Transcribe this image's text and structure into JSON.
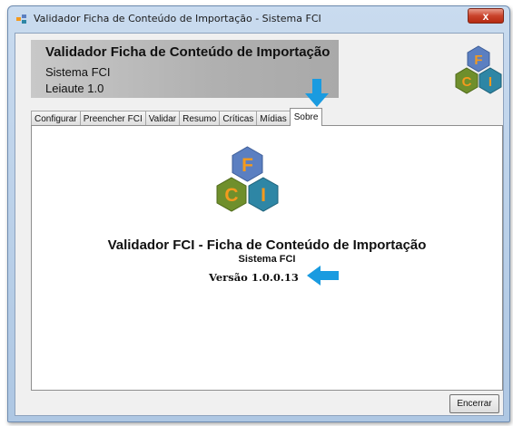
{
  "window": {
    "title": "Validador Ficha de Conteúdo de Importação - Sistema FCI",
    "close_glyph": "x"
  },
  "header": {
    "title": "Validador Ficha de Conteúdo de Importação",
    "subtitle": "Sistema FCI",
    "layout_version": "Leiaute 1.0"
  },
  "logo": {
    "letters": [
      "F",
      "C",
      "I"
    ],
    "icon": "fci-hexagon-logo"
  },
  "tabs": [
    {
      "label": "Configurar"
    },
    {
      "label": "Preencher FCI"
    },
    {
      "label": "Validar"
    },
    {
      "label": "Resumo"
    },
    {
      "label": "Críticas"
    },
    {
      "label": "Mídias"
    },
    {
      "label": "Sobre",
      "active": true
    }
  ],
  "about": {
    "title": "Validador FCI - Ficha de Conteúdo de Importação",
    "subtitle": "Sistema FCI",
    "version": "Versão 1.0.0.13"
  },
  "footer": {
    "close_button_label": "Encerrar"
  },
  "colors": {
    "annotation_arrow": "#1a9be0",
    "hex_blue": "#5b7fc1",
    "hex_green": "#6f8f2c",
    "hex_teal": "#2e86a5",
    "letter_orange": "#f39a1e"
  }
}
